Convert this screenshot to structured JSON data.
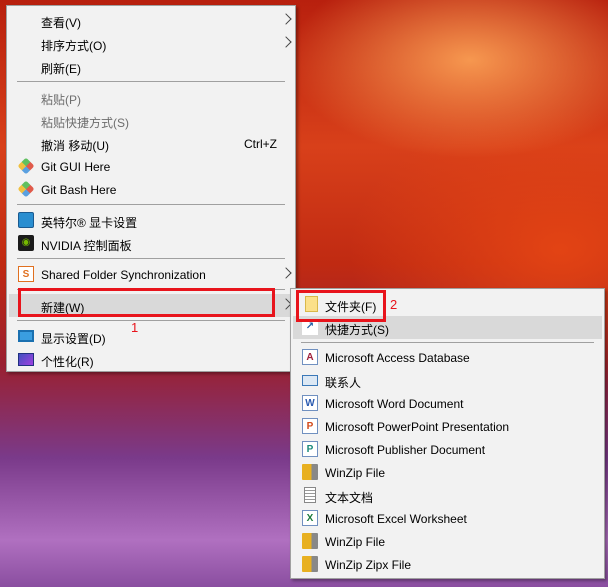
{
  "context_menu": {
    "items": [
      {
        "label": "查看(V)",
        "submenu": true
      },
      {
        "label": "排序方式(O)",
        "submenu": true
      },
      {
        "label": "刷新(E)"
      },
      {
        "separator": true
      },
      {
        "label": "粘贴(P)",
        "disabled": true
      },
      {
        "label": "粘贴快捷方式(S)",
        "disabled": true
      },
      {
        "label": "撤消 移动(U)",
        "shortcut": "Ctrl+Z"
      },
      {
        "label": "Git GUI Here",
        "icon": "git-gui-icon"
      },
      {
        "label": "Git Bash Here",
        "icon": "git-bash-icon"
      },
      {
        "separator": true
      },
      {
        "label": "英特尔® 显卡设置",
        "icon": "intel-graphics-icon"
      },
      {
        "label": "NVIDIA 控制面板",
        "icon": "nvidia-icon"
      },
      {
        "separator": true
      },
      {
        "label": "Shared Folder Synchronization",
        "icon": "shared-folder-sync-icon",
        "submenu": true
      },
      {
        "separator": true
      },
      {
        "label": "新建(W)",
        "submenu": true,
        "highlighted": true
      },
      {
        "separator": true
      },
      {
        "label": "显示设置(D)",
        "icon": "display-settings-icon"
      },
      {
        "label": "个性化(R)",
        "icon": "personalize-icon"
      }
    ]
  },
  "new_submenu": {
    "items": [
      {
        "label": "文件夹(F)",
        "icon": "folder-icon"
      },
      {
        "label": "快捷方式(S)",
        "icon": "shortcut-icon",
        "highlighted": true
      },
      {
        "separator": true
      },
      {
        "label": "Microsoft Access Database",
        "icon": "access-icon"
      },
      {
        "label": "联系人",
        "icon": "contact-icon"
      },
      {
        "label": "Microsoft Word Document",
        "icon": "word-icon"
      },
      {
        "label": "Microsoft PowerPoint Presentation",
        "icon": "powerpoint-icon"
      },
      {
        "label": "Microsoft Publisher Document",
        "icon": "publisher-icon"
      },
      {
        "label": "WinZip File",
        "icon": "winzip-icon"
      },
      {
        "label": "文本文档",
        "icon": "text-document-icon"
      },
      {
        "label": "Microsoft Excel Worksheet",
        "icon": "excel-icon"
      },
      {
        "label": "WinZip File",
        "icon": "winzip-icon"
      },
      {
        "label": "WinZip Zipx File",
        "icon": "winzip-icon"
      }
    ]
  },
  "annotations": {
    "step1": "1",
    "step2": "2"
  },
  "colors": {
    "highlight_box": "#e8141c",
    "menu_bg": "#f2f2f2",
    "hover_bg": "#d9d9d9"
  }
}
